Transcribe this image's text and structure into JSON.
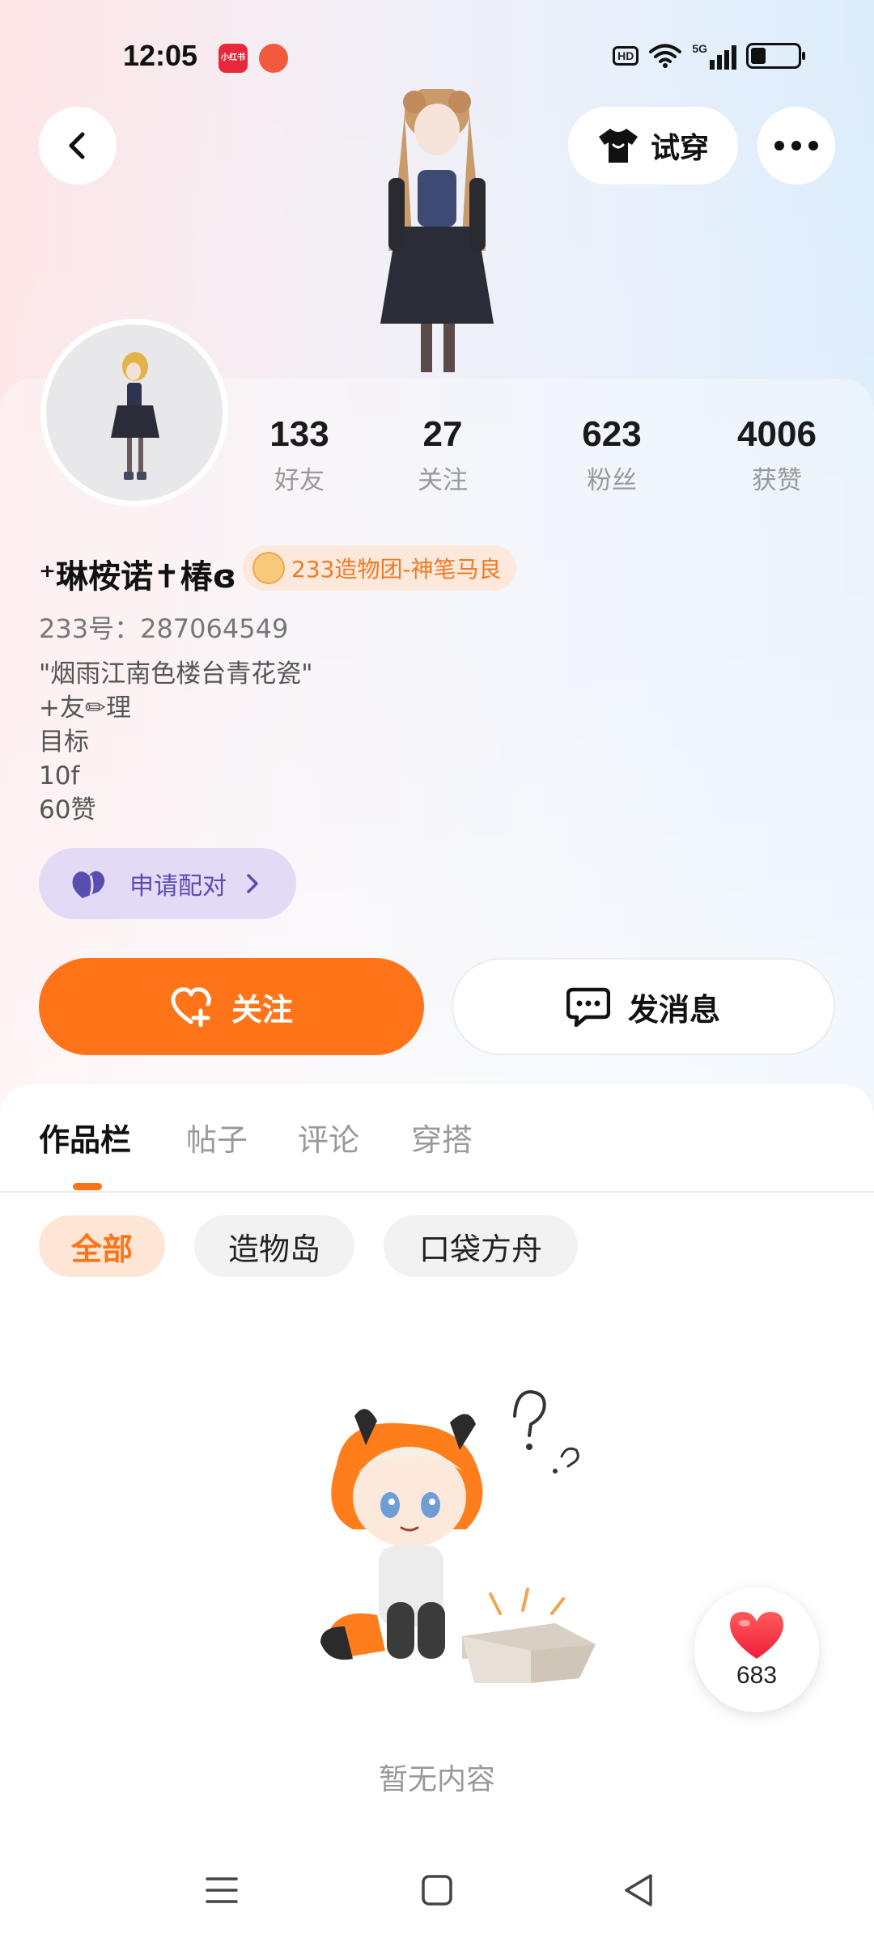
{
  "status_bar": {
    "time": "12:05",
    "app_icon_1_text": "小红书",
    "hd": "HD",
    "network": "5G",
    "battery_level_pct": 32
  },
  "header": {
    "back_icon": "chevron-left-icon",
    "tryon_label": "试穿",
    "tryon_icon": "tshirt-icon",
    "more_icon": "more-dots-icon"
  },
  "stats": [
    {
      "value": "133",
      "label": "好友"
    },
    {
      "value": "27",
      "label": "关注"
    },
    {
      "value": "623",
      "label": "粉丝"
    },
    {
      "value": "4006",
      "label": "获赞"
    }
  ],
  "profile": {
    "nickname": "⁺琳桉诺✝椿ɞ",
    "badge": "233造物团-神笔马良",
    "uid": "233号：287064549",
    "bio": [
      "\"烟雨江南色楼台青花瓷\"",
      "+友✏理",
      "目标",
      "10f",
      "60赞"
    ]
  },
  "pair": {
    "label": "申请配对",
    "icon": "heart-pair-icon"
  },
  "actions": {
    "follow_label": "关注",
    "message_label": "发消息"
  },
  "tabs": [
    {
      "label": "作品栏",
      "active": true
    },
    {
      "label": "帖子",
      "active": false
    },
    {
      "label": "评论",
      "active": false
    },
    {
      "label": "穿搭",
      "active": false
    }
  ],
  "filters": [
    {
      "label": "全部",
      "active": true
    },
    {
      "label": "造物岛",
      "active": false
    },
    {
      "label": "口袋方舟",
      "active": false
    }
  ],
  "empty_state": {
    "text": "暂无内容"
  },
  "like_fab": {
    "count": "683"
  },
  "colors": {
    "accent": "#ff7418",
    "badge_text": "#f07a24",
    "pair_bg": "#e3daf6",
    "pair_text": "#5a4db0",
    "muted": "#999999"
  }
}
